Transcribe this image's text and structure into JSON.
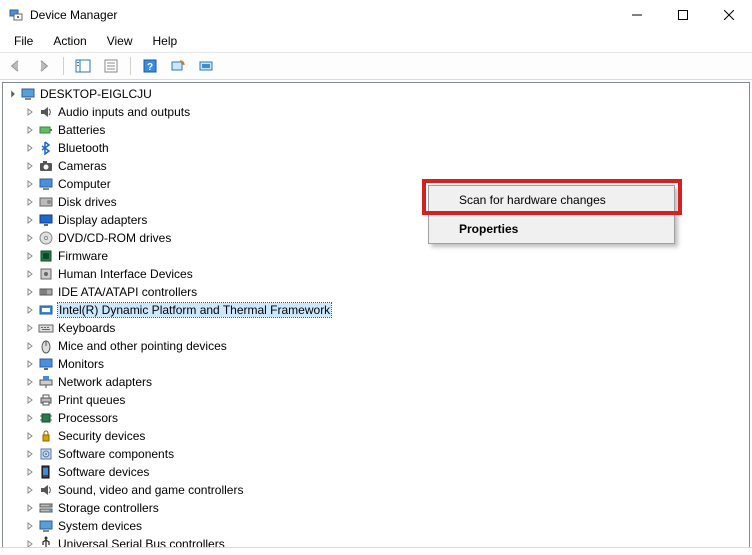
{
  "window": {
    "title": "Device Manager",
    "min_tooltip": "Minimize",
    "max_tooltip": "Maximize",
    "close_tooltip": "Close"
  },
  "menubar": {
    "items": [
      "File",
      "Action",
      "View",
      "Help"
    ]
  },
  "toolbar": {
    "back": "back-icon",
    "forward": "forward-icon",
    "show_hide": "show-hide-tree-icon",
    "properties": "properties-icon",
    "help": "help-icon",
    "scan": "scan-hardware-icon",
    "monitor": "update-driver-icon"
  },
  "tree": {
    "root": {
      "label": "DESKTOP-EIGLCJU",
      "expanded": true,
      "icon": "computer-root-icon"
    },
    "children": [
      {
        "label": "Audio inputs and outputs",
        "icon": "audio-icon"
      },
      {
        "label": "Batteries",
        "icon": "battery-icon"
      },
      {
        "label": "Bluetooth",
        "icon": "bluetooth-icon"
      },
      {
        "label": "Cameras",
        "icon": "camera-icon"
      },
      {
        "label": "Computer",
        "icon": "computer-icon"
      },
      {
        "label": "Disk drives",
        "icon": "disk-icon"
      },
      {
        "label": "Display adapters",
        "icon": "display-icon"
      },
      {
        "label": "DVD/CD-ROM drives",
        "icon": "dvd-icon"
      },
      {
        "label": "Firmware",
        "icon": "firmware-icon"
      },
      {
        "label": "Human Interface Devices",
        "icon": "hid-icon"
      },
      {
        "label": "IDE ATA/ATAPI controllers",
        "icon": "ide-icon"
      },
      {
        "label": "Intel(R) Dynamic Platform and Thermal Framework",
        "icon": "intel-thermal-icon",
        "selected": true
      },
      {
        "label": "Keyboards",
        "icon": "keyboard-icon"
      },
      {
        "label": "Mice and other pointing devices",
        "icon": "mouse-icon"
      },
      {
        "label": "Monitors",
        "icon": "monitor-icon"
      },
      {
        "label": "Network adapters",
        "icon": "network-icon"
      },
      {
        "label": "Print queues",
        "icon": "printer-icon"
      },
      {
        "label": "Processors",
        "icon": "processor-icon"
      },
      {
        "label": "Security devices",
        "icon": "security-icon"
      },
      {
        "label": "Software components",
        "icon": "software-component-icon"
      },
      {
        "label": "Software devices",
        "icon": "software-device-icon"
      },
      {
        "label": "Sound, video and game controllers",
        "icon": "sound-icon"
      },
      {
        "label": "Storage controllers",
        "icon": "storage-icon"
      },
      {
        "label": "System devices",
        "icon": "system-icon"
      },
      {
        "label": "Universal Serial Bus controllers",
        "icon": "usb-icon"
      }
    ]
  },
  "context_menu": {
    "items": [
      {
        "label": "Scan for hardware changes",
        "highlighted": true
      },
      {
        "label": "Properties",
        "default": true
      }
    ]
  },
  "colors": {
    "highlight_border": "#d6201f",
    "selection_bg": "#cce8ff"
  }
}
